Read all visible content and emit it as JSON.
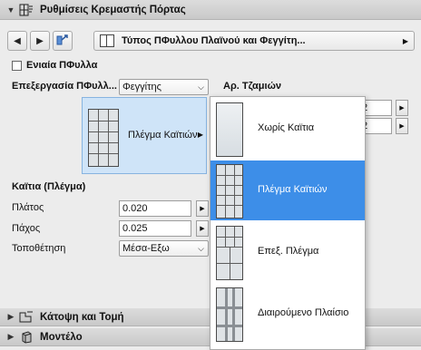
{
  "header": {
    "title": "Ρυθμίσεις Κρεμαστής Πόρτας",
    "icon": "door-settings-icon"
  },
  "toolbar": {
    "prev_icon": "triangle-left-icon",
    "next_icon": "triangle-right-icon",
    "type_label": "Τύπος ΠΦυλλου Πλαϊνού και Φεγγίτη...",
    "type_icon": "panel-type-icon"
  },
  "form": {
    "uniform_leaf_label": "Ενιαία ΠΦυλλα",
    "uniform_leaf_checked": false,
    "processing_label": "Επεξεργασία ΠΦυλλ...",
    "processing_value": "Φεγγίτης",
    "glass_count_label": "Αρ. Τζαμιών",
    "glass_count_values": [
      "2",
      "2"
    ],
    "grid_tile_label": "Πλέγμα Καϊτιών",
    "mullions_section": "Καϊτια (Πλέγμα)",
    "width_label": "Πλάτος",
    "width_value": "0.020",
    "thickness_label": "Πάχος",
    "thickness_value": "0.025",
    "placement_label": "Τοποθέτηση",
    "placement_value": "Μέσα-Εξω"
  },
  "popup": {
    "items": [
      {
        "label": "Χωρίς Καϊτια",
        "selected": false
      },
      {
        "label": "Πλέγμα Καϊτιών",
        "selected": true
      },
      {
        "label": "Επεξ. Πλέγμα",
        "selected": false
      },
      {
        "label": "Διαιρούμενο Πλαίσιο",
        "selected": false
      }
    ]
  },
  "sections": {
    "plan_label": "Κάτοψη και Τομή",
    "model_label": "Μοντέλο"
  },
  "colors": {
    "selection": "#3d8ee8",
    "tile_bg": "#cfe4f8"
  }
}
